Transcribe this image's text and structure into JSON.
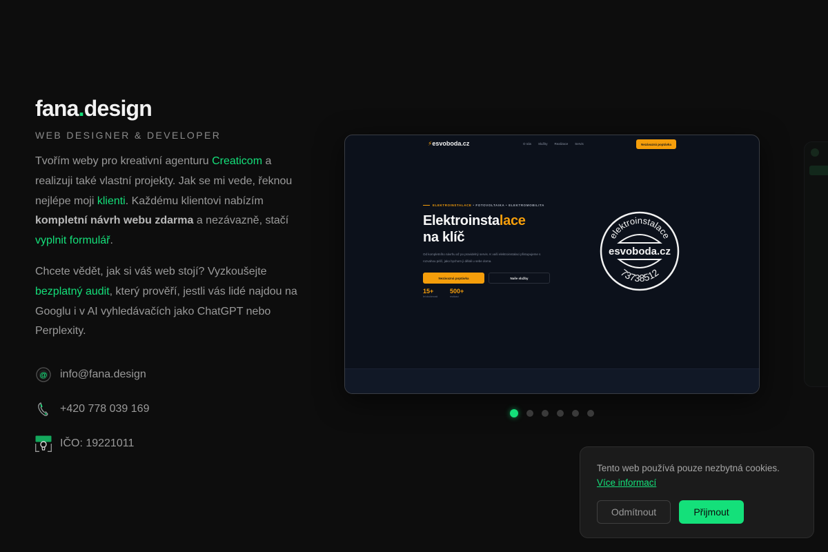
{
  "brand": {
    "name_part1": "fana",
    "dot": ".",
    "name_part2": "design",
    "accent": "#14e07a"
  },
  "subtitle": "WEB DESIGNER & DEVELOPER",
  "intro": {
    "t1": "Tvořím weby pro kreativní agenturu ",
    "link_agency": "Creaticom",
    "t2": " a realizuji také vlastní projekty. Jak se mi vede, řeknou nejlépe moji ",
    "link_clients": "klienti",
    "t3": ". Každému klientovi nabízím ",
    "bold": "kompletní návrh webu zdarma",
    "t4": " a nezávazně, stačí ",
    "link_form": "vyplnit formulář",
    "t5": "."
  },
  "audit": {
    "t1": "Chcete vědět, jak si váš web stojí? Vyzkoušejte ",
    "link_audit": "bezplatný audit",
    "t2": ", který prověří, jestli vás lidé najdou na Googlu i v AI vyhledávačích jako ChatGPT nebo Perplexity."
  },
  "contacts": {
    "email": {
      "icon": "at-icon",
      "value": "info@fana.design"
    },
    "phone": {
      "icon": "phone-icon",
      "value": "+420 778 039 169"
    },
    "ico": {
      "icon": "id-card-icon",
      "value": "IČO: 19221011"
    }
  },
  "slide": {
    "logo": "esvoboda.cz",
    "nav_links": [
      "O nás",
      "Služby",
      "Realizace",
      "Servis"
    ],
    "nav_cta": "Nezávazná poptávka",
    "kicker_accent": "ELEKTROINSTALACE",
    "kicker_rest": " • FOTOVOLTAIKA • ELEKTROMOBILITA",
    "h1_line1_a": "Elektroinsta",
    "h1_line1_b": "lace",
    "h1_line2": "na klíč",
    "paragraph": "Od kompletního návrhu až po pravidelný servis. K vaší elektroinstalaci přistupujeme s rozvahou péčí, jako bychom ji dělali u sebe doma.",
    "btn_primary": "Nezávazná poptávka",
    "btn_secondary": "Naše služby",
    "stats": [
      {
        "number": "15+",
        "label": "let zkušeností"
      },
      {
        "number": "500+",
        "label": "realizací"
      }
    ],
    "stamp_top": "elektroinstalace",
    "stamp_middle": "esvoboda.cz",
    "stamp_bottom": "73738512",
    "accent": "#f59e0b"
  },
  "carousel": {
    "total": 6,
    "active": 1
  },
  "cookie": {
    "text": "Tento web používá pouze nezbytná cookies.",
    "more": "Více informací",
    "decline": "Odmítnout",
    "accept": "Přijmout"
  }
}
